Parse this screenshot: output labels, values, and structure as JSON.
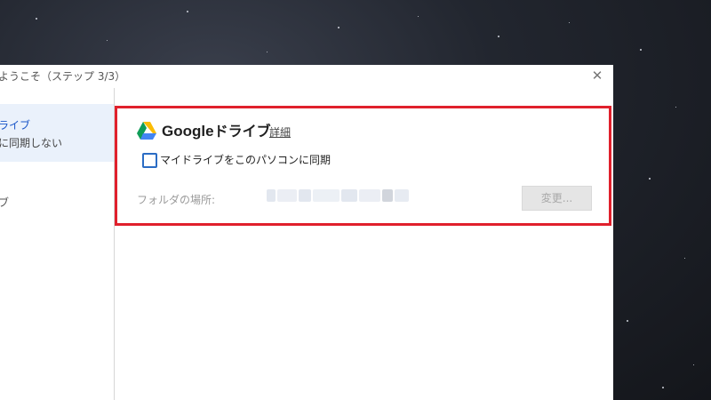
{
  "window": {
    "title": "ようこそ（ステップ 3/3）",
    "close_icon": "close-icon"
  },
  "sidebar": {
    "items": [
      {
        "label": "ライブ",
        "sublabel": "に同期しない",
        "selected": true
      },
      {
        "label": "ブ",
        "selected": false
      }
    ]
  },
  "panel": {
    "logo_icon": "google-drive-logo-icon",
    "title_brand": "Google",
    "title_rest": "ドライブ",
    "details_link": "詳細",
    "sync_checkbox_label": "マイドライブをこのパソコンに同期",
    "sync_checked": false,
    "folder_label": "フォルダの場所:",
    "change_button": "変更..."
  },
  "colors": {
    "accent_red": "#e0202c",
    "checkbox_blue": "#2b6cc4",
    "sidebar_active": "#eaf1fb"
  }
}
